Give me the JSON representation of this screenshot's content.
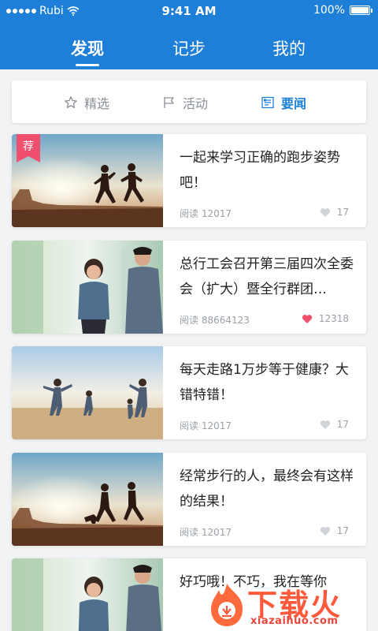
{
  "status": {
    "carrier": "Rubi",
    "time": "9:41 AM",
    "battery": "100%"
  },
  "top_tabs": [
    {
      "label": "发现",
      "active": true
    },
    {
      "label": "记步",
      "active": false
    },
    {
      "label": "我的",
      "active": false
    }
  ],
  "sub_tabs": [
    {
      "label": "精选",
      "icon": "star-icon",
      "active": false
    },
    {
      "label": "活动",
      "icon": "flag-icon",
      "active": false
    },
    {
      "label": "要闻",
      "icon": "news-icon",
      "active": true
    }
  ],
  "badge": "荐",
  "articles": [
    {
      "title": "一起来学习正确的跑步姿势吧！",
      "reads": "阅读 12017",
      "likes": "17",
      "liked": false,
      "image": "running-couple-desert",
      "recommended": true
    },
    {
      "title": "总行工会召开第三届四次全委会（扩大）暨全行群团…",
      "reads": "阅读 88664123",
      "likes": "12318",
      "liked": true,
      "image": "jogging-couple-park",
      "recommended": false
    },
    {
      "title": "每天走路1万步等于健康？大错特错！",
      "reads": "阅读 12017",
      "likes": "17",
      "liked": false,
      "image": "family-running-beach",
      "recommended": false
    },
    {
      "title": "经常步行的人，最终会有这样的结果！",
      "reads": "阅读 12017",
      "likes": "17",
      "liked": false,
      "image": "running-couple-dog",
      "recommended": false
    },
    {
      "title": "好巧哦！不巧，我在等你",
      "reads": "",
      "likes": "",
      "liked": false,
      "image": "jogging-couple-park",
      "recommended": false
    }
  ],
  "watermark": {
    "name": "下载火",
    "url": "xiazaihuo.com"
  },
  "colors": {
    "primary": "#1e7fd8",
    "badge": "#f0506e",
    "like_active": "#f0506e",
    "like_inactive": "#d0d3d8"
  }
}
